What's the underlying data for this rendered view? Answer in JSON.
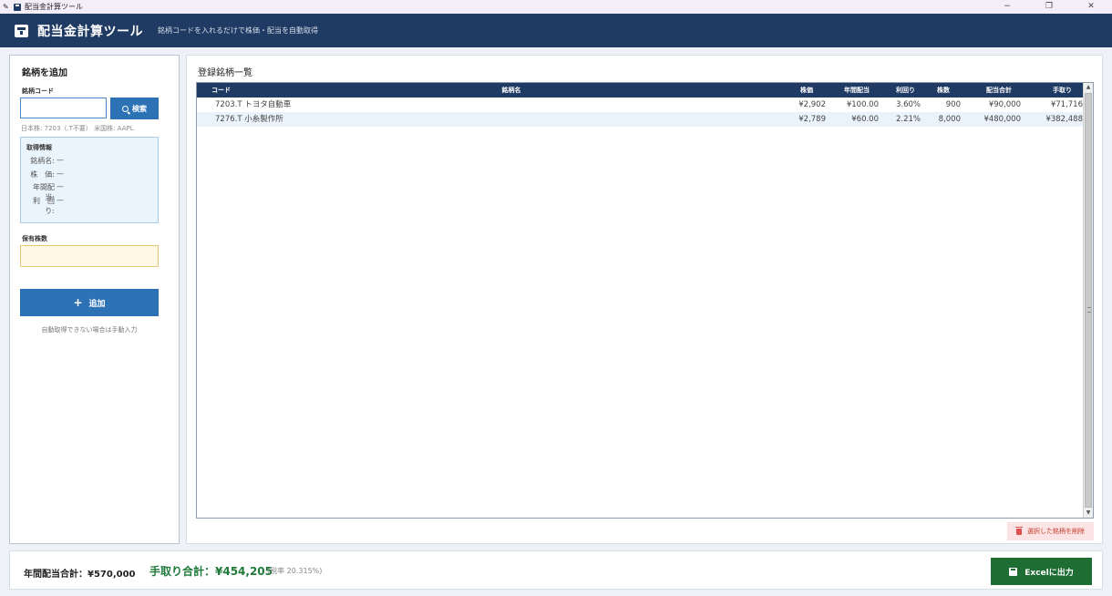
{
  "window": {
    "title": "配当金計算ツール",
    "controls": {
      "minimize": "−",
      "restore": "❐",
      "close": "✕"
    }
  },
  "header": {
    "title": "配当金計算ツール",
    "subtitle": "銘柄コードを入れるだけで株価・配当を自動取得"
  },
  "left_panel": {
    "title": "銘柄を追加",
    "code_label": "銘柄コード",
    "code_value": "",
    "search_label": "検索",
    "hint": "日本株: 7203（.T不要）  米国株: AAPL",
    "info": {
      "title": "取得情報",
      "rows": [
        {
          "key": "銘柄名:",
          "value": "—"
        },
        {
          "key": "株　価:",
          "value": "—"
        },
        {
          "key": "年間配当:",
          "value": "—"
        },
        {
          "key": "利　回り:",
          "value": "—"
        }
      ]
    },
    "shares_label": "保有株数",
    "shares_value": "",
    "add_label": "追加",
    "add_icon": "+",
    "add_note": "自動取得できない場合は手動入力"
  },
  "right_panel": {
    "title": "登録銘柄一覧",
    "columns": {
      "code": "コード",
      "name": "銘柄名",
      "price": "株価",
      "dividend": "年間配当",
      "yield": "利回り",
      "shares": "株数",
      "total": "配当合計",
      "net": "手取り"
    },
    "rows": [
      {
        "code": "7203.T  トヨタ自動車",
        "price": "¥2,902",
        "dividend": "¥100.00",
        "yield": "3.60%",
        "shares": "900",
        "total": "¥90,000",
        "net": "¥71,716"
      },
      {
        "code": "7276.T  小糸製作所",
        "price": "¥2,789",
        "dividend": "¥60.00",
        "yield": "2.21%",
        "shares": "8,000",
        "total": "¥480,000",
        "net": "¥382,488"
      }
    ],
    "delete_label": "選択した銘柄を削除"
  },
  "footer": {
    "annual": "年間配当合計：¥570,000",
    "net": "手取り合計：¥454,205",
    "tax": "(税率 20.315%)",
    "excel_label": "Excelに出力"
  }
}
